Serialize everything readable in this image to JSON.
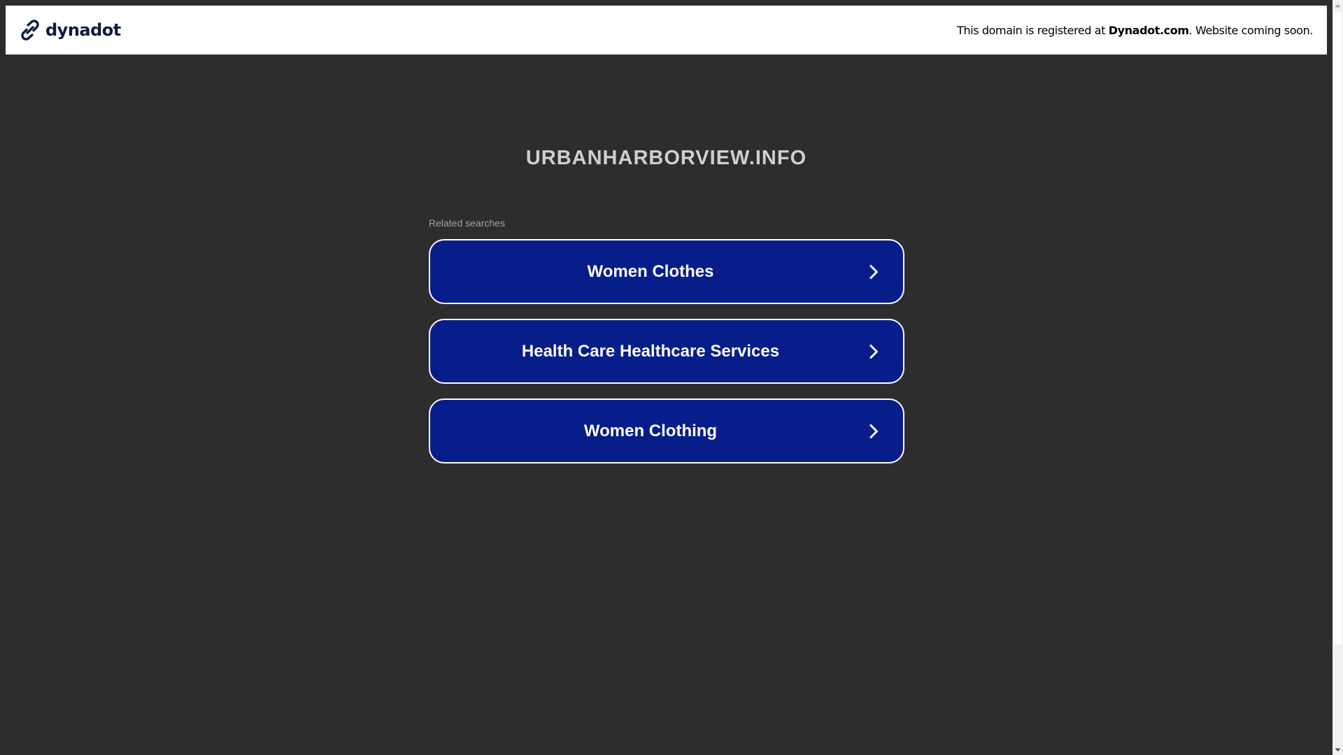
{
  "header": {
    "brand_name": "dynadot",
    "notice_prefix": "This domain is registered at ",
    "notice_link": "Dynadot.com",
    "notice_suffix": ". Website coming soon."
  },
  "main": {
    "domain_title": "URBANHARBORVIEW.INFO",
    "related_label": "Related searches",
    "links": [
      {
        "label": "Women Clothes"
      },
      {
        "label": "Health Care Healthcare Services"
      },
      {
        "label": "Women Clothing"
      }
    ]
  },
  "colors": {
    "background": "#2d2d2d",
    "button_fill": "#071d8a",
    "brand": "#0b1c3f"
  },
  "icons": {
    "brand": "dynadot-link-logo-icon",
    "link_arrow": "chevron-right-icon"
  }
}
